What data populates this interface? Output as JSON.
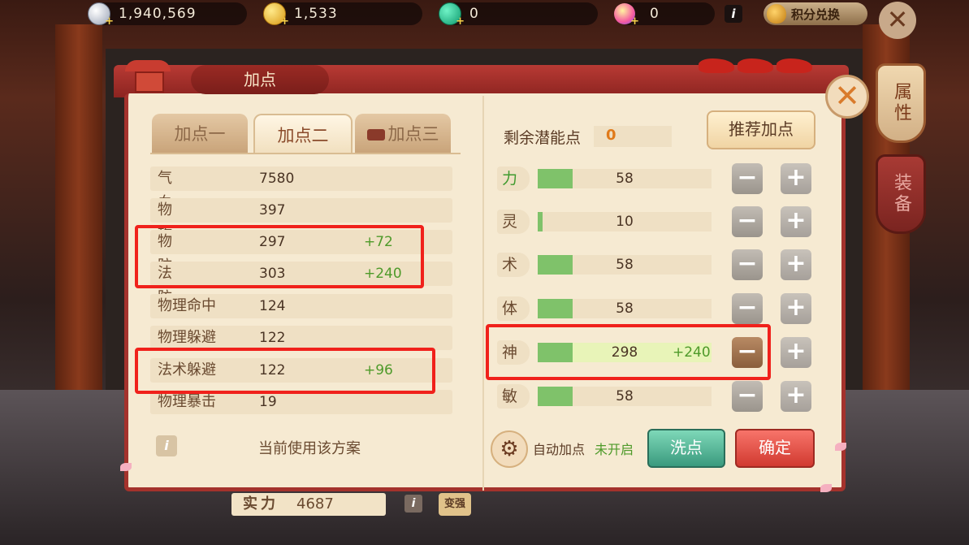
{
  "topbar": {
    "silver": "1,940,569",
    "gold": "1,533",
    "green": "0",
    "drop": "0",
    "info": "i",
    "exchange_label": "积分兑换",
    "close_glyph": "✕"
  },
  "side_tabs": [
    "属性",
    "装备"
  ],
  "panel": {
    "title": "加点",
    "close_glyph": "✕"
  },
  "tabs": [
    {
      "label": "加点一",
      "active": false
    },
    {
      "label": "加点二",
      "active": true
    },
    {
      "label": "加点三",
      "active": false
    }
  ],
  "stats": [
    {
      "name": "气血",
      "value": "7580",
      "bonus": ""
    },
    {
      "name": "物攻",
      "value": "397",
      "bonus": ""
    },
    {
      "name": "物防",
      "value": "297",
      "bonus": "+72"
    },
    {
      "name": "法防",
      "value": "303",
      "bonus": "+240"
    },
    {
      "name": "物理命中",
      "value": "124",
      "bonus": ""
    },
    {
      "name": "物理躲避",
      "value": "122",
      "bonus": ""
    },
    {
      "name": "法术躲避",
      "value": "122",
      "bonus": "+96"
    },
    {
      "name": "物理暴击",
      "value": "19",
      "bonus": ""
    }
  ],
  "left_footer": {
    "info": "i",
    "scheme_text": "当前使用该方案"
  },
  "right": {
    "potential_label": "剩余潜能点",
    "potential_value": "0",
    "recommend_label": "推荐加点",
    "minus_glyph": "−",
    "plus_glyph": "+",
    "attributes": [
      {
        "label": "力",
        "value": "58",
        "bonus": "",
        "fill": 0.2
      },
      {
        "label": "灵",
        "value": "10",
        "bonus": "",
        "fill": 0.03
      },
      {
        "label": "术",
        "value": "58",
        "bonus": "",
        "fill": 0.2
      },
      {
        "label": "体",
        "value": "58",
        "bonus": "",
        "fill": 0.2
      },
      {
        "label": "神",
        "value": "298",
        "bonus": "+240",
        "fill": 0.2
      },
      {
        "label": "敏",
        "value": "58",
        "bonus": "",
        "fill": 0.2
      }
    ],
    "auto_label": "自动加点",
    "auto_state": "未开启",
    "gear_glyph": "⚙",
    "wash_label": "洗点",
    "confirm_label": "确定"
  },
  "bottom": {
    "power_label": "实力",
    "power_value": "4687",
    "info": "i",
    "upgrade_label": "变强"
  },
  "colors": {
    "accent_red": "#a4322c",
    "bonus_green": "#4e9a2a",
    "highlight_box": "#f0211b",
    "confirm_red": "#d13a30",
    "wash_teal": "#3a9a7e"
  }
}
